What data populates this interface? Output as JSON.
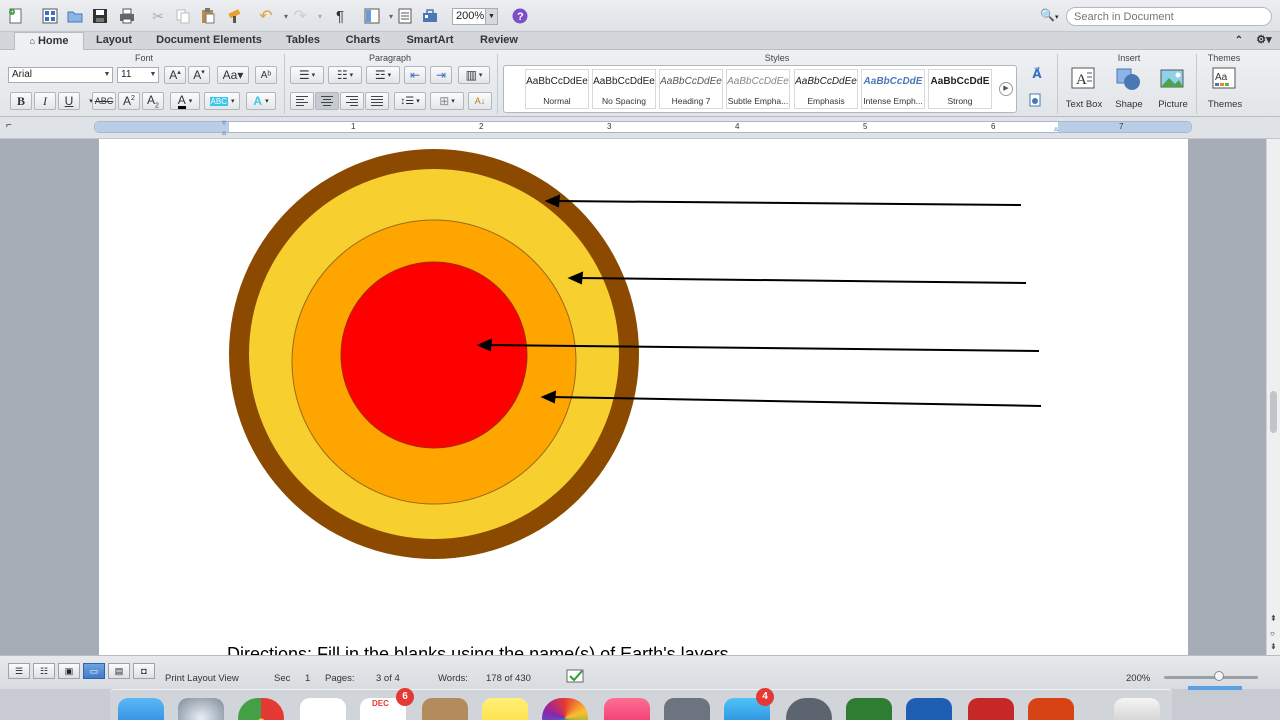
{
  "toolbar": {
    "zoom": "200%",
    "search_placeholder": "Search in Document"
  },
  "tabs": [
    {
      "label": "Home",
      "active": true
    },
    {
      "label": "Layout"
    },
    {
      "label": "Document Elements"
    },
    {
      "label": "Tables"
    },
    {
      "label": "Charts"
    },
    {
      "label": "SmartArt"
    },
    {
      "label": "Review"
    }
  ],
  "ribbon": {
    "font_group": "Font",
    "paragraph_group": "Paragraph",
    "styles_group": "Styles",
    "insert_group": "Insert",
    "themes_group": "Themes",
    "font_name": "Arial",
    "font_size": "11",
    "styles": [
      {
        "sample": "AaBbCcDdEe",
        "name": "Normal"
      },
      {
        "sample": "AaBbCcDdEe",
        "name": "No Spacing"
      },
      {
        "sample": "AaBbCcDdEe",
        "name": "Heading 7"
      },
      {
        "sample": "AaBbCcDdEe",
        "name": "Subtle Empha..."
      },
      {
        "sample": "AaBbCcDdEe",
        "name": "Emphasis"
      },
      {
        "sample": "AaBbCcDdE",
        "name": "Intense Emph..."
      },
      {
        "sample": "AaBbCcDdE",
        "name": "Strong"
      }
    ],
    "insert_text_box": "Text Box",
    "insert_shape": "Shape",
    "insert_picture": "Picture",
    "themes_button": "Themes"
  },
  "ruler": {
    "numbers": [
      "1",
      "2",
      "3",
      "4",
      "5",
      "6",
      "7"
    ]
  },
  "document": {
    "directions": "Directions: Fill in the blanks using the name(s) of Earth's layers.",
    "diagram": {
      "layer_colors": {
        "crust": "#8b4a00",
        "mantle": "#f7cf2e",
        "outer_core": "#ffa500",
        "inner_core": "#ff0000"
      }
    }
  },
  "status": {
    "view": "Print Layout View",
    "sec_label": "Sec",
    "sec_value": "1",
    "pages_label": "Pages:",
    "pages_value": "3 of 4",
    "words_label": "Words:",
    "words_value": "178 of 430",
    "zoom": "200%"
  },
  "dock": {
    "calendar_month": "DEC",
    "calendar_badge": "6",
    "appstore_badge": "4"
  }
}
